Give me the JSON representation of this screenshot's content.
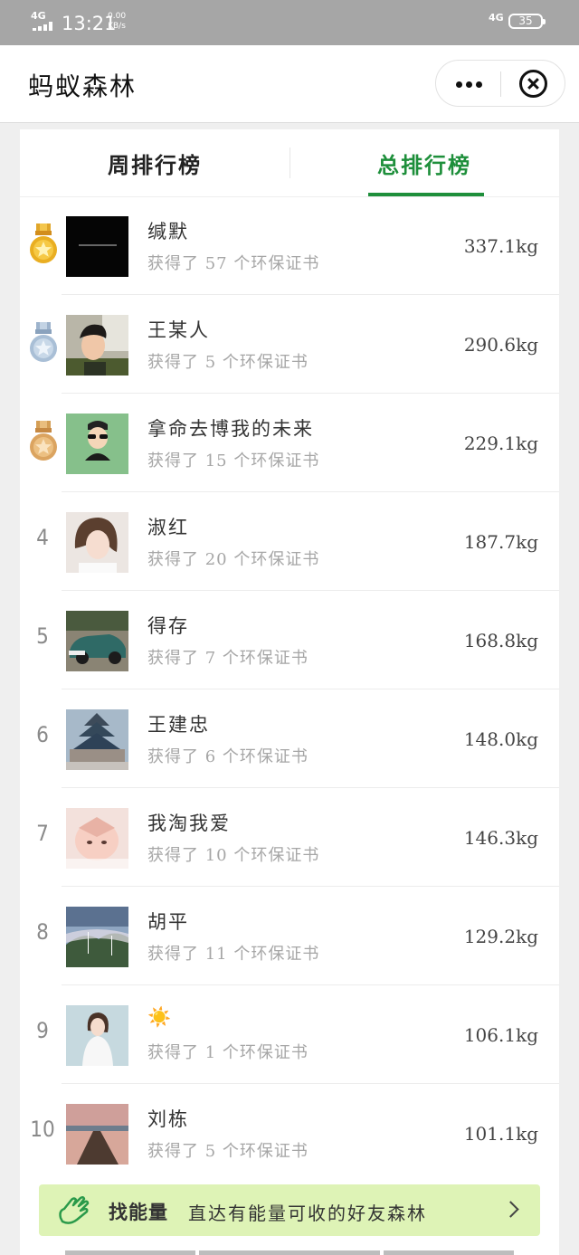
{
  "status_bar": {
    "network_left": "4G",
    "time": "13:21",
    "speed_value": "0.00",
    "speed_unit": "KB/s",
    "network_right": "4G",
    "battery": "35"
  },
  "nav": {
    "title": "蚂蚁森林"
  },
  "tabs": [
    {
      "label": "周排行榜",
      "active": false
    },
    {
      "label": "总排行榜",
      "active": true
    }
  ],
  "subtitle_prefix": "获得了",
  "subtitle_suffix": "个环保证书",
  "ranking": [
    {
      "rank": "1",
      "medal": "gold-medal-icon",
      "name": "缄默",
      "certificates": "57",
      "energy": "337.1kg",
      "avatar": "dark-square-avatar"
    },
    {
      "rank": "2",
      "medal": "silver-medal-icon",
      "name": "王某人",
      "certificates": "5",
      "energy": "290.6kg",
      "avatar": "selfie-man-avatar"
    },
    {
      "rank": "3",
      "medal": "bronze-medal-icon",
      "name": "拿命去博我的未来",
      "certificates": "15",
      "energy": "229.1kg",
      "avatar": "cartoon-sunglasses-avatar"
    },
    {
      "rank": "4",
      "name": "淑红",
      "certificates": "20",
      "energy": "187.7kg",
      "avatar": "girl-portrait-avatar"
    },
    {
      "rank": "5",
      "name": "得存",
      "certificates": "7",
      "energy": "168.8kg",
      "avatar": "green-car-avatar"
    },
    {
      "rank": "6",
      "name": "王建忠",
      "certificates": "6",
      "energy": "148.0kg",
      "avatar": "temple-avatar"
    },
    {
      "rank": "7",
      "name": "我淘我爱",
      "certificates": "10",
      "energy": "146.3kg",
      "avatar": "baby-face-avatar"
    },
    {
      "rank": "8",
      "name": "胡平",
      "certificates": "11",
      "energy": "129.2kg",
      "avatar": "mountain-avatar"
    },
    {
      "rank": "9",
      "name": "☀️",
      "certificates": "1",
      "energy": "106.1kg",
      "avatar": "girl-white-dress-avatar"
    },
    {
      "rank": "10",
      "name": "刘栋",
      "certificates": "5",
      "energy": "101.1kg",
      "avatar": "pier-sunset-avatar"
    }
  ],
  "banner": {
    "title": "找能量",
    "description": "直达有能量可收的好友森林",
    "icon": "hand-icon"
  }
}
